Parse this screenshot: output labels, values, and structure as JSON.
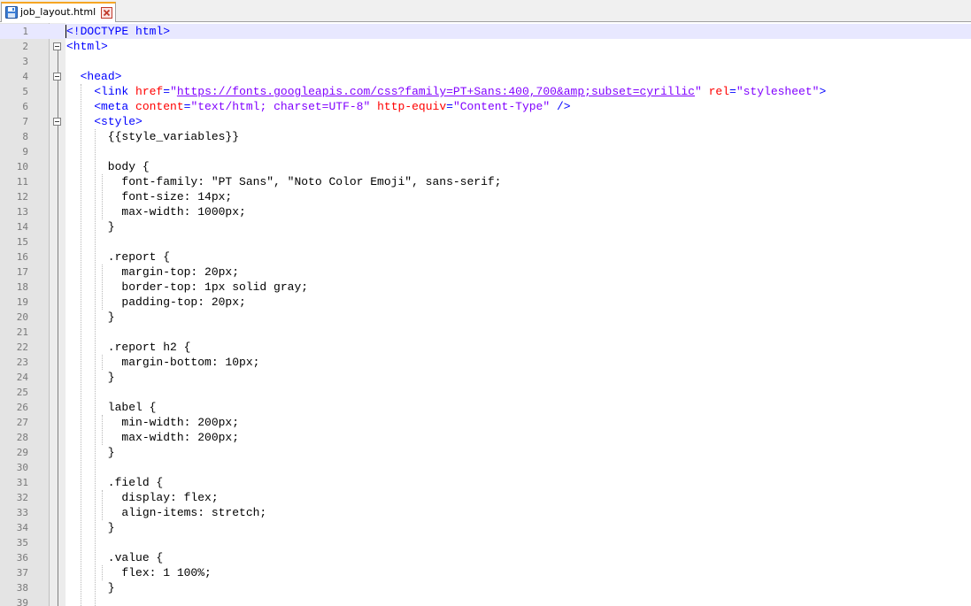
{
  "tab": {
    "filename": "job_layout.html",
    "file_icon": "save-disk-icon",
    "close_icon": "close-icon"
  },
  "editor": {
    "current_line": 1,
    "lines": [
      {
        "n": "1",
        "tokens": [
          {
            "t": "tag",
            "s": "<!DOCTYPE html>"
          }
        ]
      },
      {
        "n": "2",
        "tokens": [
          {
            "t": "tag",
            "s": "<html>"
          }
        ]
      },
      {
        "n": "3",
        "tokens": []
      },
      {
        "n": "4",
        "tokens": [
          {
            "t": "text",
            "s": "  "
          },
          {
            "t": "tag",
            "s": "<head>"
          }
        ]
      },
      {
        "n": "5",
        "tokens": [
          {
            "t": "text",
            "s": "    "
          },
          {
            "t": "tag",
            "s": "<link "
          },
          {
            "t": "attr",
            "s": "href"
          },
          {
            "t": "tag",
            "s": "="
          },
          {
            "t": "val",
            "s": "\""
          },
          {
            "t": "url",
            "s": "https://fonts.googleapis.com/css?family=PT+Sans:400,700&amp;subset=cyrillic"
          },
          {
            "t": "val",
            "s": "\""
          },
          {
            "t": "text",
            "s": " "
          },
          {
            "t": "attr",
            "s": "rel"
          },
          {
            "t": "tag",
            "s": "="
          },
          {
            "t": "val",
            "s": "\"stylesheet\""
          },
          {
            "t": "tag",
            "s": ">"
          }
        ]
      },
      {
        "n": "6",
        "tokens": [
          {
            "t": "text",
            "s": "    "
          },
          {
            "t": "tag",
            "s": "<meta "
          },
          {
            "t": "attr",
            "s": "content"
          },
          {
            "t": "tag",
            "s": "="
          },
          {
            "t": "val",
            "s": "\"text/html; charset=UTF-8\""
          },
          {
            "t": "text",
            "s": " "
          },
          {
            "t": "attr",
            "s": "http-equiv"
          },
          {
            "t": "tag",
            "s": "="
          },
          {
            "t": "val",
            "s": "\"Content-Type\""
          },
          {
            "t": "text",
            "s": " "
          },
          {
            "t": "tag",
            "s": "/>"
          }
        ]
      },
      {
        "n": "7",
        "tokens": [
          {
            "t": "text",
            "s": "    "
          },
          {
            "t": "tag",
            "s": "<style>"
          }
        ]
      },
      {
        "n": "8",
        "tokens": [
          {
            "t": "text",
            "s": "      {{style_variables}}"
          }
        ]
      },
      {
        "n": "9",
        "tokens": []
      },
      {
        "n": "10",
        "tokens": [
          {
            "t": "text",
            "s": "      body {"
          }
        ]
      },
      {
        "n": "11",
        "tokens": [
          {
            "t": "text",
            "s": "        font-family: \"PT Sans\", \"Noto Color Emoji\", sans-serif;"
          }
        ]
      },
      {
        "n": "12",
        "tokens": [
          {
            "t": "text",
            "s": "        font-size: 14px;"
          }
        ]
      },
      {
        "n": "13",
        "tokens": [
          {
            "t": "text",
            "s": "        max-width: 1000px;"
          }
        ]
      },
      {
        "n": "14",
        "tokens": [
          {
            "t": "text",
            "s": "      }"
          }
        ]
      },
      {
        "n": "15",
        "tokens": []
      },
      {
        "n": "16",
        "tokens": [
          {
            "t": "text",
            "s": "      .report {"
          }
        ]
      },
      {
        "n": "17",
        "tokens": [
          {
            "t": "text",
            "s": "        margin-top: 20px;"
          }
        ]
      },
      {
        "n": "18",
        "tokens": [
          {
            "t": "text",
            "s": "        border-top: 1px solid gray;"
          }
        ]
      },
      {
        "n": "19",
        "tokens": [
          {
            "t": "text",
            "s": "        padding-top: 20px;"
          }
        ]
      },
      {
        "n": "20",
        "tokens": [
          {
            "t": "text",
            "s": "      }"
          }
        ]
      },
      {
        "n": "21",
        "tokens": []
      },
      {
        "n": "22",
        "tokens": [
          {
            "t": "text",
            "s": "      .report h2 {"
          }
        ]
      },
      {
        "n": "23",
        "tokens": [
          {
            "t": "text",
            "s": "        margin-bottom: 10px;"
          }
        ]
      },
      {
        "n": "24",
        "tokens": [
          {
            "t": "text",
            "s": "      }"
          }
        ]
      },
      {
        "n": "25",
        "tokens": []
      },
      {
        "n": "26",
        "tokens": [
          {
            "t": "text",
            "s": "      label {"
          }
        ]
      },
      {
        "n": "27",
        "tokens": [
          {
            "t": "text",
            "s": "        min-width: 200px;"
          }
        ]
      },
      {
        "n": "28",
        "tokens": [
          {
            "t": "text",
            "s": "        max-width: 200px;"
          }
        ]
      },
      {
        "n": "29",
        "tokens": [
          {
            "t": "text",
            "s": "      }"
          }
        ]
      },
      {
        "n": "30",
        "tokens": []
      },
      {
        "n": "31",
        "tokens": [
          {
            "t": "text",
            "s": "      .field {"
          }
        ]
      },
      {
        "n": "32",
        "tokens": [
          {
            "t": "text",
            "s": "        display: flex;"
          }
        ]
      },
      {
        "n": "33",
        "tokens": [
          {
            "t": "text",
            "s": "        align-items: stretch;"
          }
        ]
      },
      {
        "n": "34",
        "tokens": [
          {
            "t": "text",
            "s": "      }"
          }
        ]
      },
      {
        "n": "35",
        "tokens": []
      },
      {
        "n": "36",
        "tokens": [
          {
            "t": "text",
            "s": "      .value {"
          }
        ]
      },
      {
        "n": "37",
        "tokens": [
          {
            "t": "text",
            "s": "        flex: 1 100%;"
          }
        ]
      },
      {
        "n": "38",
        "tokens": [
          {
            "t": "text",
            "s": "      }"
          }
        ]
      },
      {
        "n": "39",
        "tokens": []
      }
    ]
  }
}
